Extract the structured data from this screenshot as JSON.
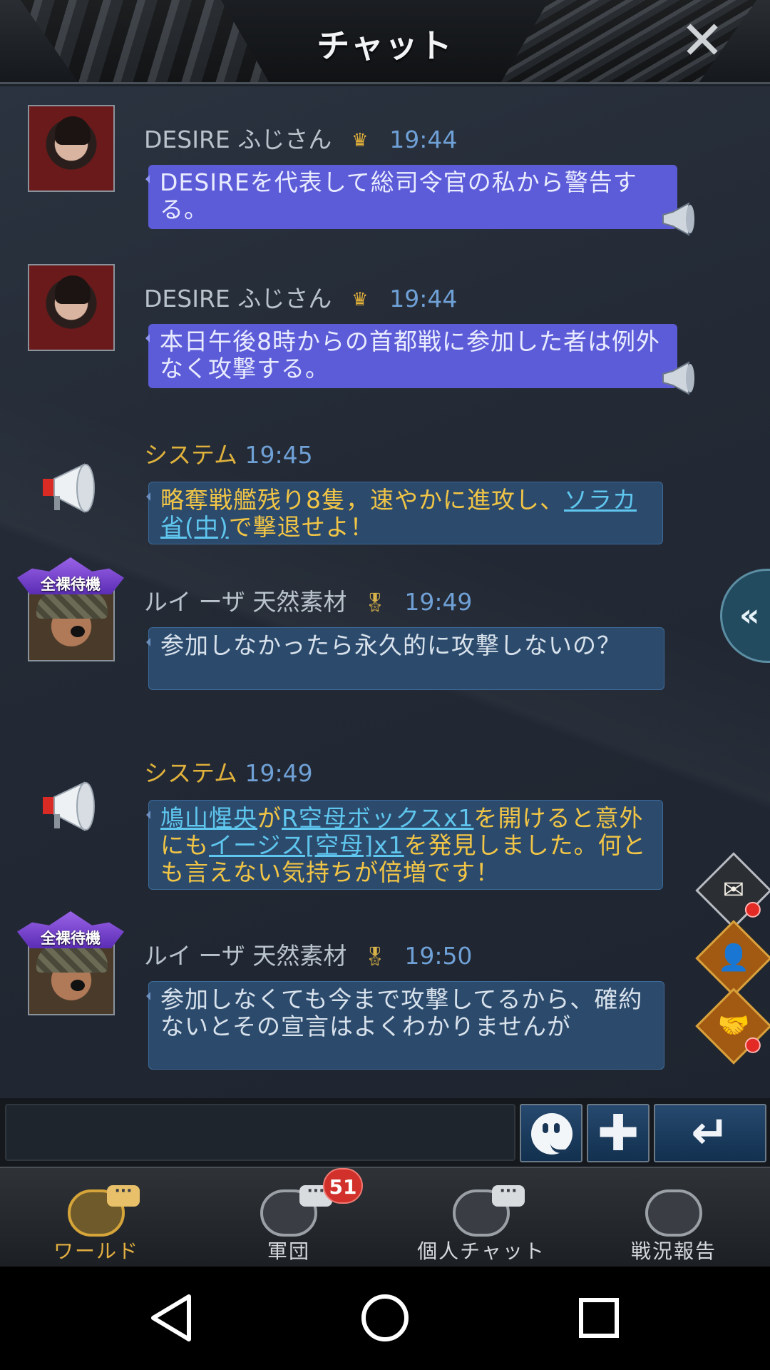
{
  "header": {
    "title": "チャット"
  },
  "messages": [
    {
      "name": "DESIRE ふじさん",
      "time": "19:44",
      "text": "DESIREを代表して総司令官の私から警告する。"
    },
    {
      "name": "DESIRE ふじさん",
      "time": "19:44",
      "text": "本日午後8時からの首都戦に参加した者は例外なく攻撃する。"
    },
    {
      "name": "システム",
      "time": "19:45",
      "text_a": "略奪戦艦残り8隻，速やかに進攻し、",
      "link_a": "ソラカ省(中)",
      "text_b": "で撃退せよ！"
    },
    {
      "badge": "全裸待機",
      "name": "ルイ ーザ 天然素材",
      "time": "19:49",
      "text": "参加しなかったら永久的に攻撃しないの？"
    },
    {
      "name": "システム",
      "time": "19:49",
      "link_a": "鳩山惺央",
      "text_a": "が",
      "link_b": "R空母ボックスx1",
      "text_b": "を開けると意外にも",
      "link_c": "イージス[空母]x1",
      "text_c": "を発見しました。何とも言えない気持ちが倍増です！"
    },
    {
      "badge": "全裸待機",
      "name": "ルイ ーザ 天然素材",
      "time": "19:50",
      "text": "参加しなくても今まで攻撃してるから、確約ないとその宣言はよくわかりませんが"
    }
  ],
  "input": {
    "value": "",
    "placeholder": ""
  },
  "tabs": [
    {
      "label": "ワールド",
      "active": true
    },
    {
      "label": "軍団",
      "badge": "51"
    },
    {
      "label": "個人チャット"
    },
    {
      "label": "戦況報告"
    }
  ],
  "colors": {
    "accent": "#e2ae41",
    "link": "#5fc6ee",
    "system": "#f1c546",
    "vip_bubble": "#5d5cd8"
  }
}
